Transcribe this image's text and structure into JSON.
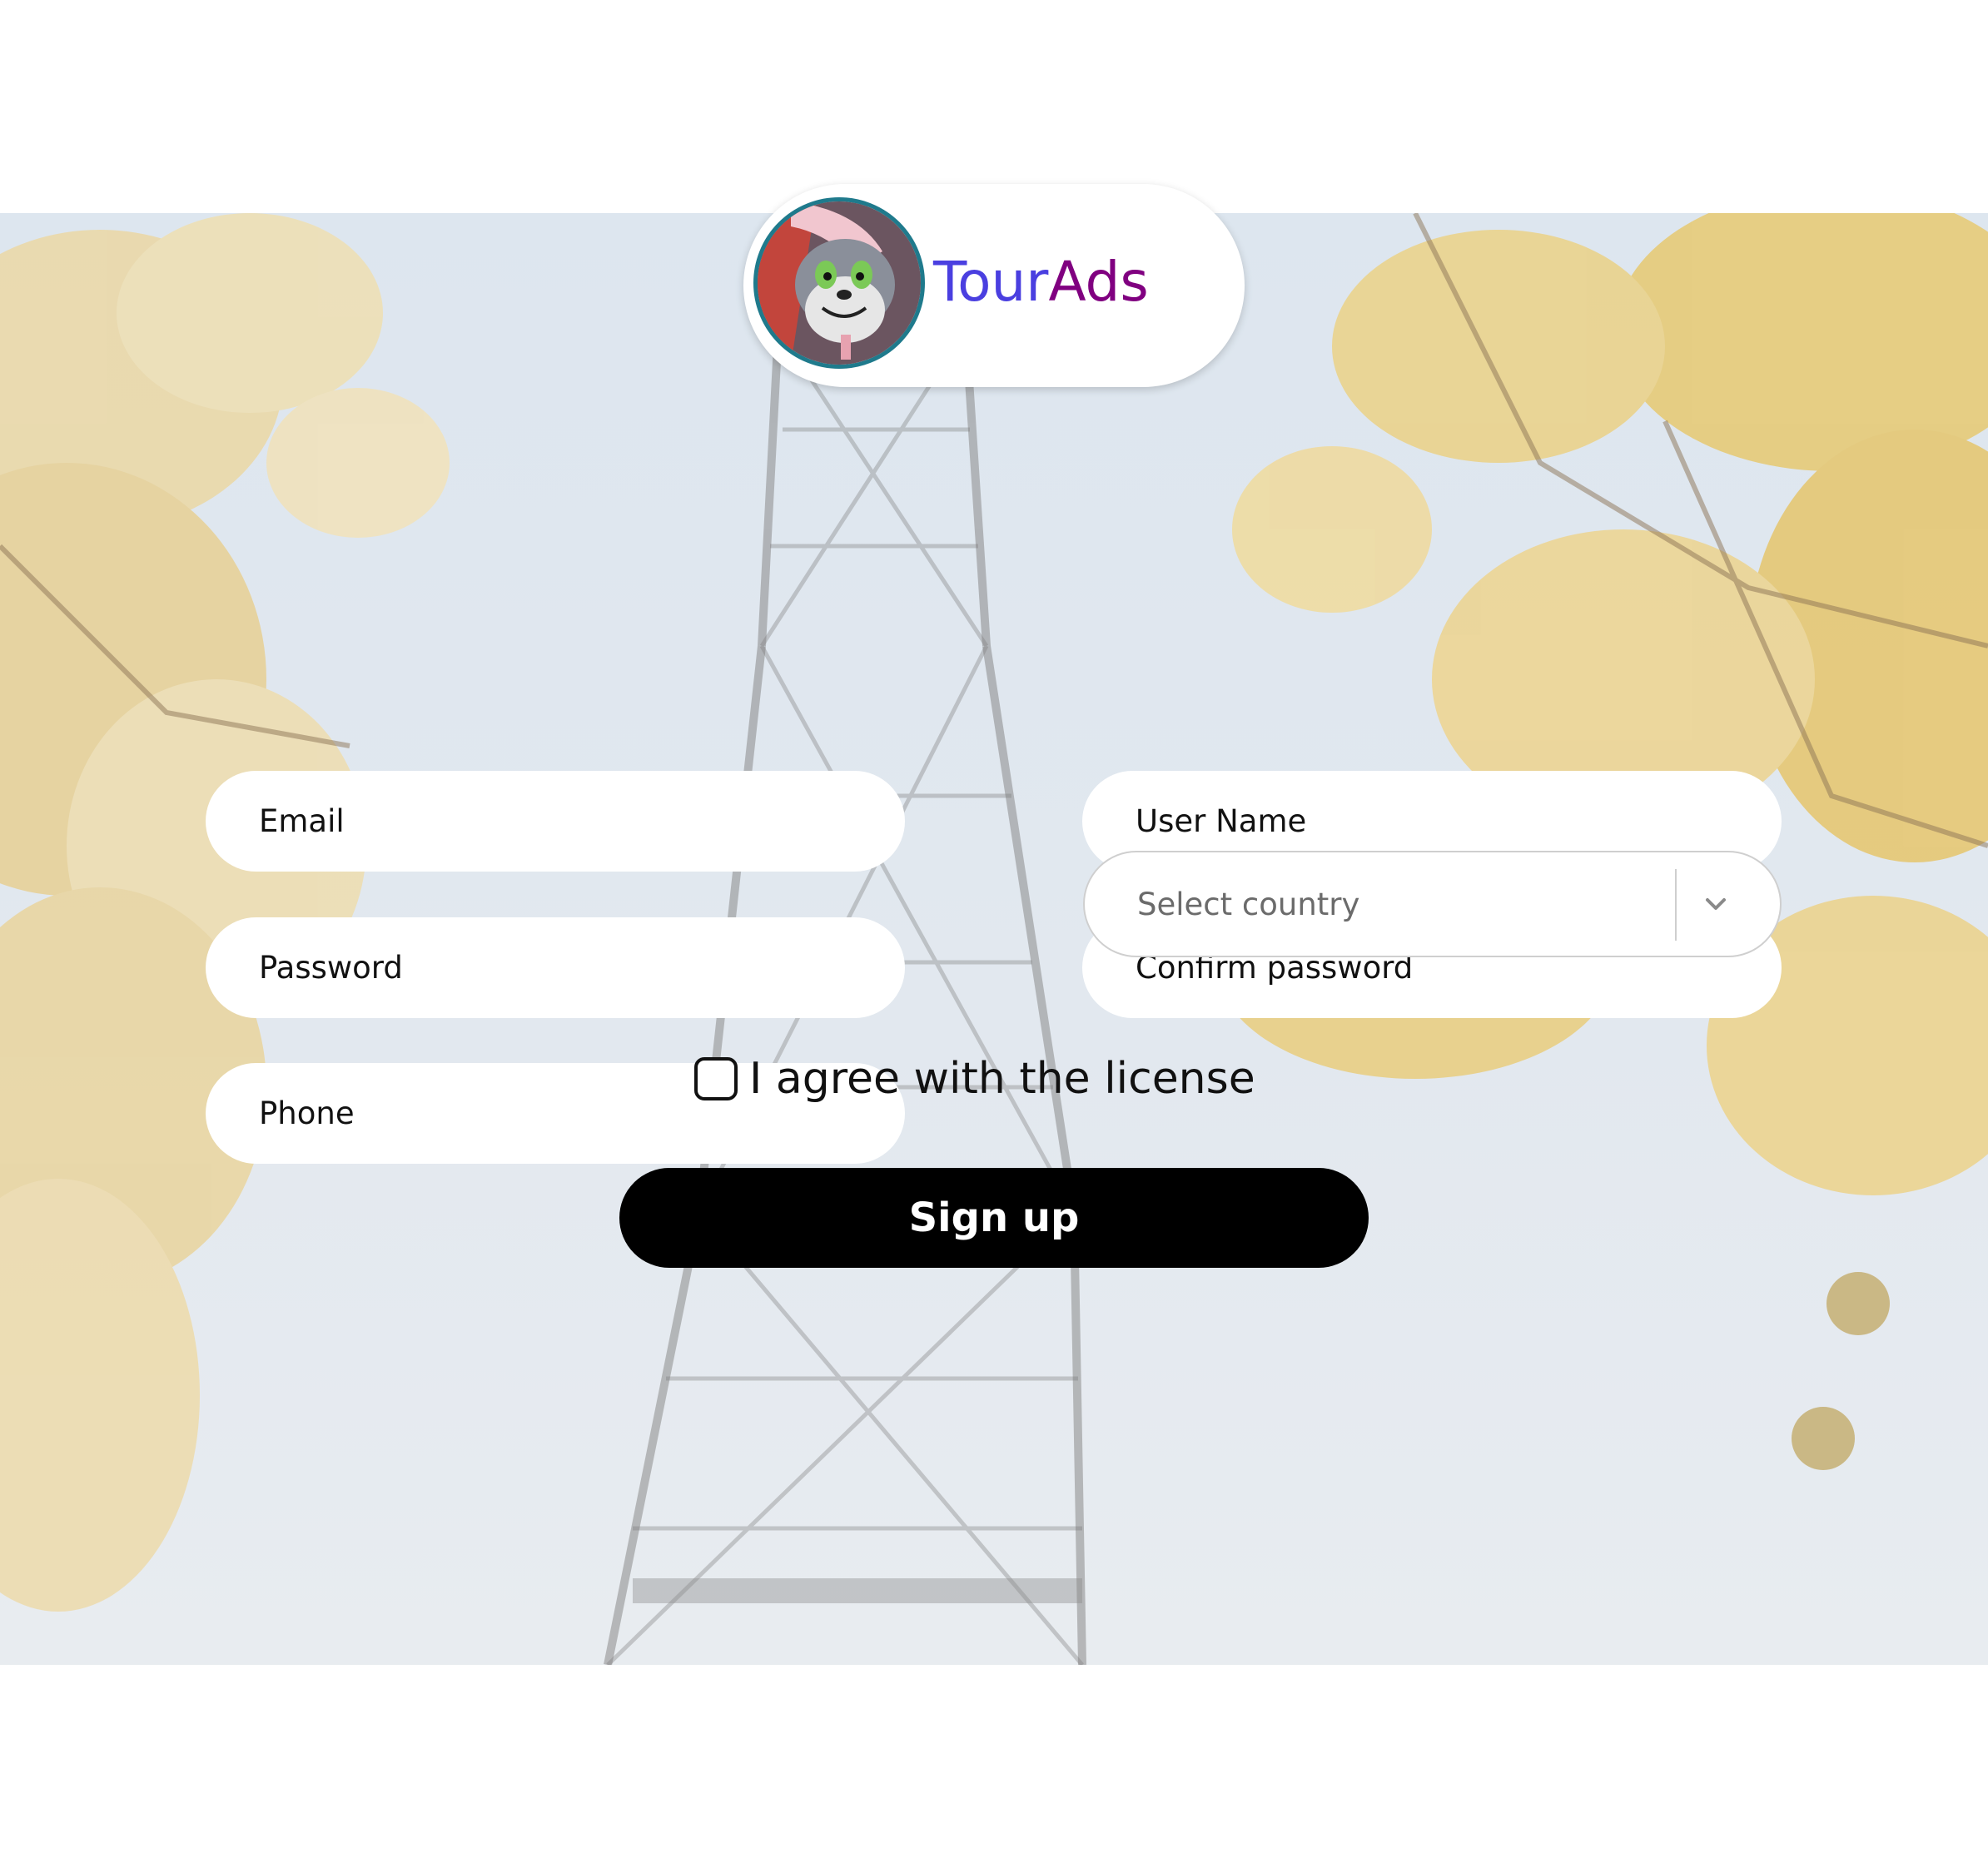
{
  "brand": {
    "name_part1": "Tour",
    "name_part2": "Ads",
    "color_part1": "#4a3fe0",
    "color_part2": "#800080"
  },
  "form": {
    "email_placeholder": "Email",
    "username_placeholder": "User Name",
    "password_placeholder": "Password",
    "confirm_password_placeholder": "Confirm password",
    "phone_placeholder": "Phone",
    "country_placeholder": "Select country",
    "license_label": "I agree with the license",
    "license_checked": false,
    "submit_label": "Sign up"
  },
  "icons": {
    "avatar": "cartoon-cat-avatar-icon",
    "dropdown": "chevron-down-icon"
  },
  "colors": {
    "button_bg": "#000000",
    "button_text": "#ffffff",
    "field_bg": "#ffffff"
  }
}
